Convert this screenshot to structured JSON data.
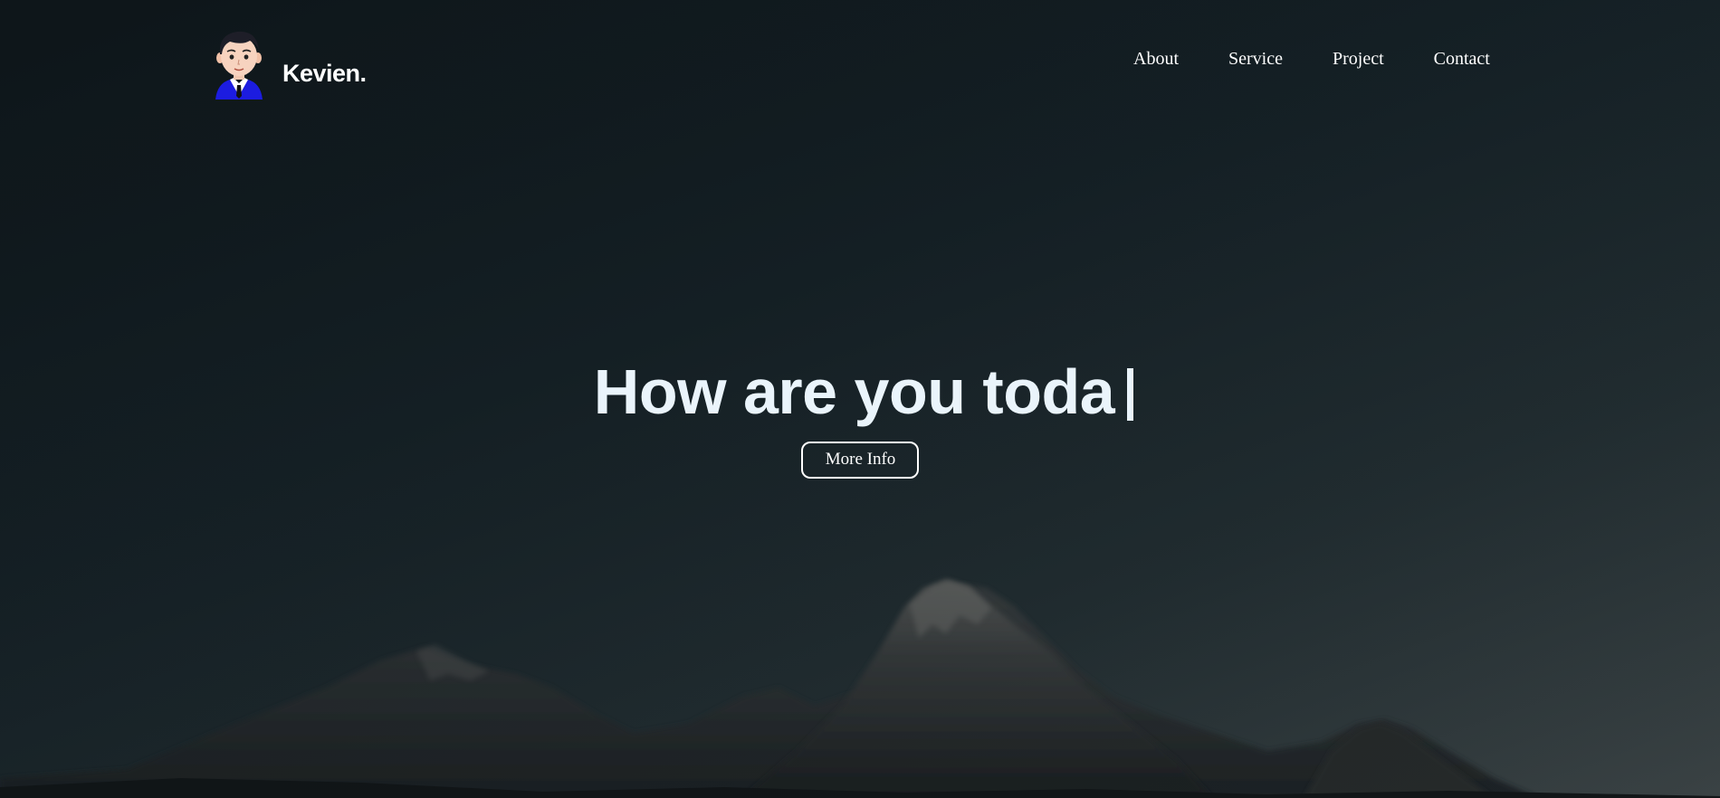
{
  "brand": {
    "name": "Kevien.",
    "avatar_icon": "avatar-cartoon-man-icon"
  },
  "nav": {
    "items": [
      {
        "label": "About"
      },
      {
        "label": "Service"
      },
      {
        "label": "Project"
      },
      {
        "label": "Contact"
      }
    ]
  },
  "hero": {
    "headline": "How are you toda",
    "button_label": "More Info",
    "background_icon": "mountain-landscape-icon"
  },
  "colors": {
    "background_dark": "#101a1f",
    "headline": "#eaf4fb",
    "text": "#ffffff"
  }
}
